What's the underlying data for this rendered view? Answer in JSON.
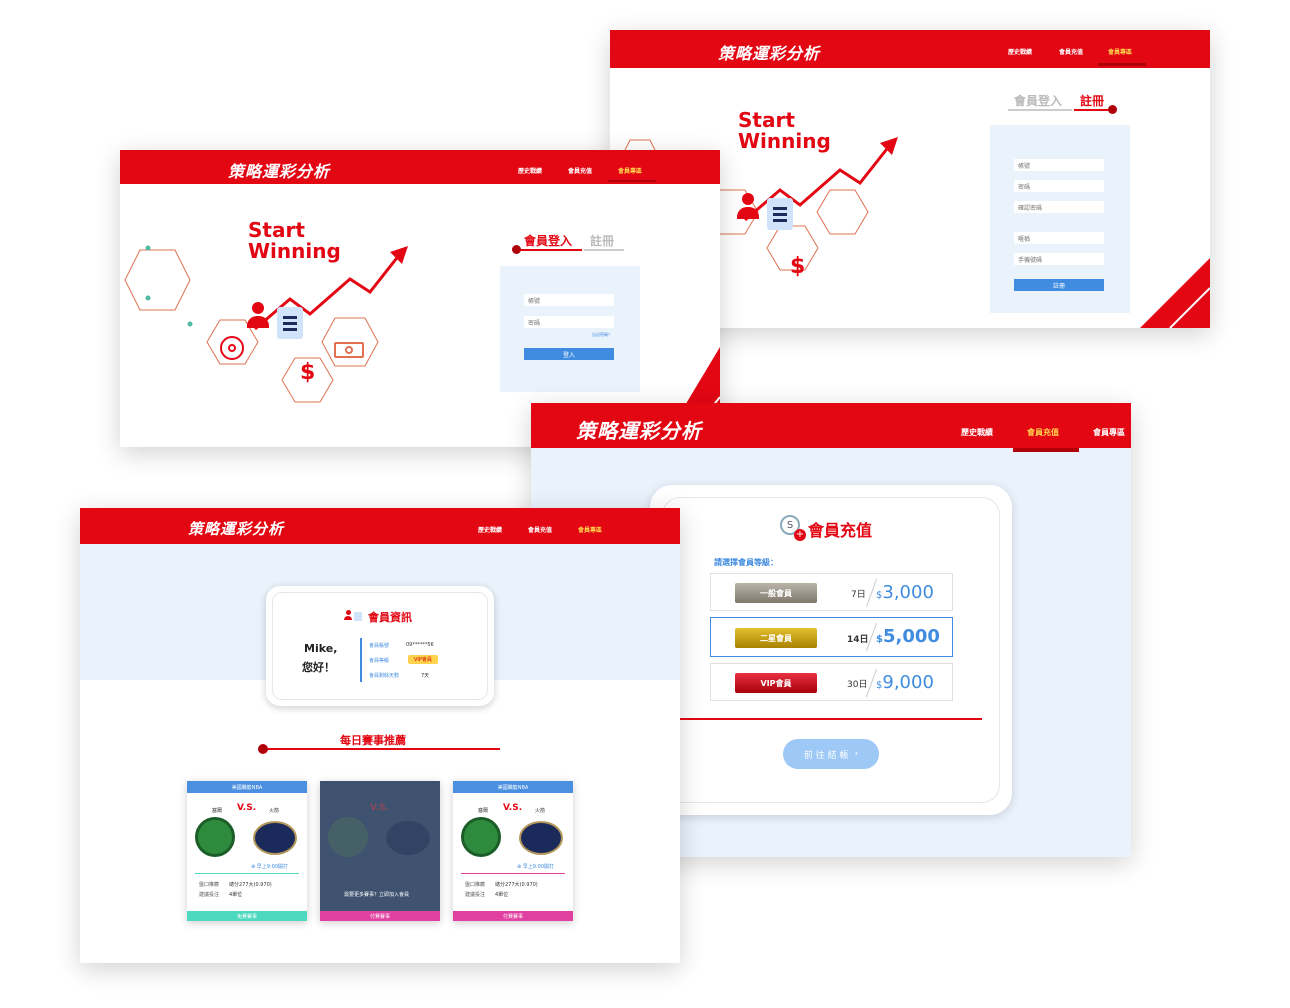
{
  "logo": "策略運彩分析",
  "nav": [
    "歷史戰績",
    "會員充值",
    "會員專區"
  ],
  "hero": {
    "line1": "Start",
    "line2": "Winning"
  },
  "login_screen": {
    "tab_login": "會員登入",
    "tab_register": "註冊",
    "account_placeholder": "帳號",
    "password_placeholder": "密碼",
    "forgot": "忘記密碼？",
    "submit": "登入"
  },
  "register_screen": {
    "tab_login": "會員登入",
    "tab_register": "註冊",
    "fields": [
      "帳號",
      "密碼",
      "確認密碼",
      "暱稱",
      "手機號碼"
    ],
    "submit": "註冊"
  },
  "recharge_screen": {
    "title": "會員充值",
    "coin_symbol": "S",
    "prompt": "請選擇會員等級：",
    "plans": [
      {
        "label": "一般會員",
        "days": "7日",
        "currency": "$",
        "price": "3,000",
        "color": "#9a9488"
      },
      {
        "label": "二星會員",
        "days": "14日",
        "currency": "$",
        "price": "5,000",
        "color": "#c9a000"
      },
      {
        "label": "VIP會員",
        "days": "30日",
        "currency": "$",
        "price": "9,000",
        "color": "#d0101c"
      }
    ],
    "checkout": "前 往 結 帳"
  },
  "member_screen": {
    "info_title": "會員資訊",
    "greeting_line1": "Mike,",
    "greeting_line2": "您好！",
    "rows": [
      {
        "label": "會員帳號",
        "value": "09******56"
      },
      {
        "label": "會員等級",
        "value": "VIP會員"
      },
      {
        "label": "會員剩餘天數",
        "value": "7天"
      }
    ],
    "daily_title": "每日賽事推薦",
    "cards": [
      {
        "league": "美國職籃NBA",
        "home": "塞爾",
        "vs": "V.S.",
        "away": "火箭",
        "time": "⊕ 早上9:00開打",
        "rec_label": "盤口推薦",
        "rec_value": "總分277大(0.970)",
        "bet_label": "建議投注",
        "bet_value": "4單位",
        "footer": "免費賽事",
        "footer_color": "#4dd9c0"
      },
      {
        "league": "",
        "vs": "V.S.",
        "locked_msg": "需要更多賽事？立即加入會員",
        "footer": "付費賽事",
        "footer_color": "#e040a0"
      },
      {
        "league": "美國職籃NBA",
        "home": "塞爾",
        "vs": "V.S.",
        "away": "火箭",
        "time": "⊕ 早上9:00開打",
        "rec_label": "盤口推薦",
        "rec_value": "總分277大(0.970)",
        "bet_label": "建議投注",
        "bet_value": "4單位",
        "footer": "付費賽事",
        "footer_color": "#e040a0"
      }
    ]
  },
  "colors": {
    "brand": "#e30613",
    "accent_blue": "#3f8ce0",
    "form_bg": "#eaf2fc"
  }
}
